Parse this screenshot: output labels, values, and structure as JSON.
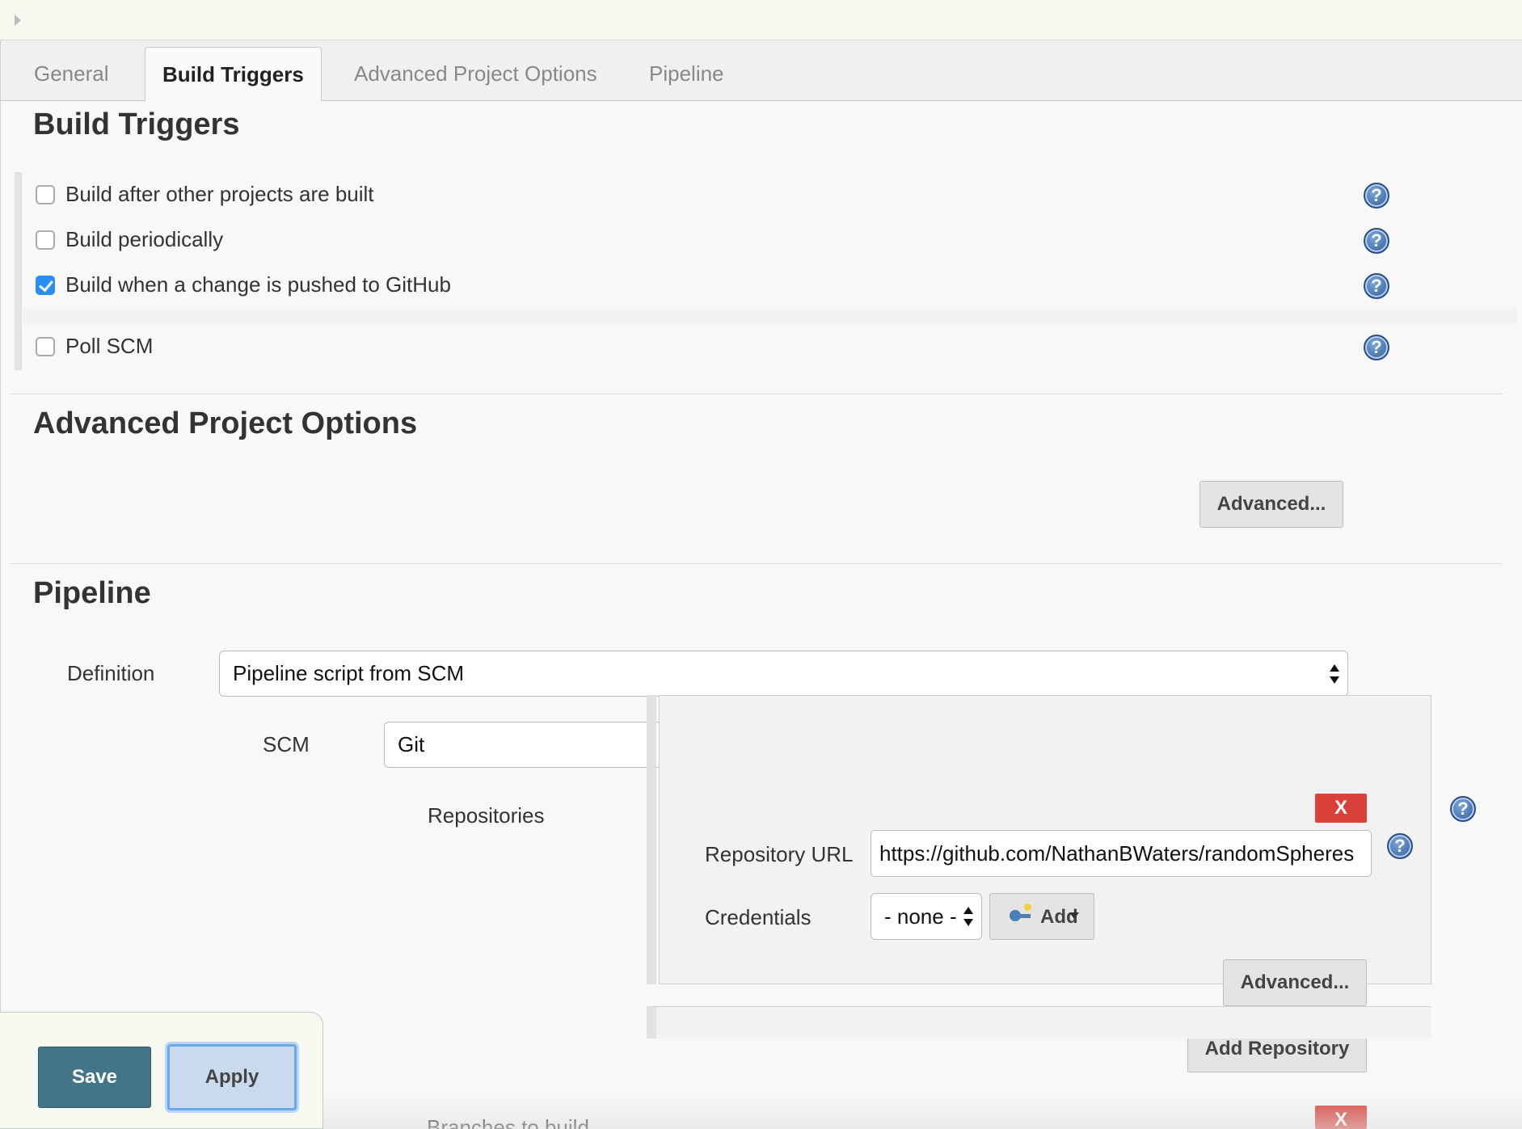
{
  "tabs": [
    {
      "label": "General"
    },
    {
      "label": "Build Triggers"
    },
    {
      "label": "Advanced Project Options"
    },
    {
      "label": "Pipeline"
    }
  ],
  "build_triggers": {
    "heading": "Build Triggers",
    "items": [
      {
        "label": "Build after other projects are built",
        "checked": false
      },
      {
        "label": "Build periodically",
        "checked": false
      },
      {
        "label": "Build when a change is pushed to GitHub",
        "checked": true
      },
      {
        "label": "Poll SCM",
        "checked": false
      }
    ]
  },
  "advanced_options": {
    "heading": "Advanced Project Options",
    "advanced_button": "Advanced..."
  },
  "pipeline": {
    "heading": "Pipeline",
    "definition_label": "Definition",
    "definition_value": "Pipeline script from SCM",
    "scm_label": "SCM",
    "scm_value": "Git",
    "repositories_label": "Repositories",
    "remove_label": "X",
    "repository_url_label": "Repository URL",
    "repository_url_value": "https://github.com/NathanBWaters/randomSpheres",
    "credentials_label": "Credentials",
    "credentials_value": "- none -",
    "add_label": "Add",
    "advanced_button": "Advanced...",
    "add_repository_button": "Add Repository",
    "branches_label": "Branches to build"
  },
  "footer": {
    "save_label": "Save",
    "apply_label": "Apply"
  },
  "help_icon_glyph": "?",
  "colors": {
    "save_button": "#417587",
    "apply_button": "#c9d9ee",
    "remove_button": "#d9403a",
    "checkbox_checked": "#2b8ef2"
  }
}
